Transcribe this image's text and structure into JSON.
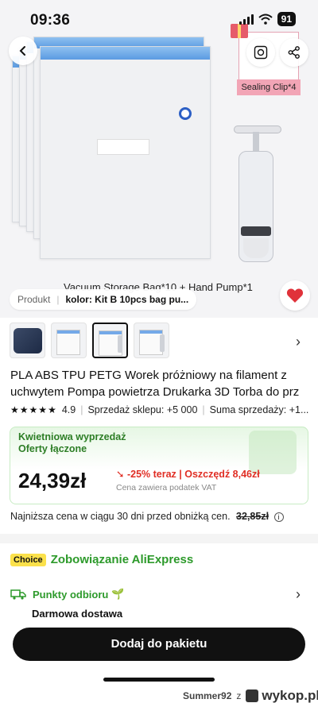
{
  "status_bar": {
    "time": "09:36",
    "battery": "91"
  },
  "hero": {
    "clip_label": "Sealing Clip*4",
    "caption": "Vacuum Storage Bag*10 + Hand Pump*1"
  },
  "breadcrumb": {
    "tab": "Produkt",
    "variant": "kolor: Kit B 10pcs bag pu..."
  },
  "product": {
    "title_line1": "PLA ABS TPU PETG Worek próżniowy na filament z",
    "title_line2": "uchwytem Pompa powietrza Drukarka 3D Torba do prz",
    "rating": "4.9",
    "shop_sales": "Sprzedaż sklepu: +5 000",
    "total_sales": "Suma sprzedaży: +1..."
  },
  "promo": {
    "line1": "Kwietniowa wyprzedaż",
    "line2": "Oferty łączone",
    "price": "24,39zł",
    "discount": "-25% teraz | Oszczędź 8,46zł",
    "vat_note": "Cena zawiera podatek VAT"
  },
  "lowest_price": {
    "text": "Najniższa cena w ciągu 30 dni przed obniżką cen.",
    "old_price": "32,85zł"
  },
  "choice": {
    "badge": "Choice",
    "text": "Zobowiązanie AliExpress"
  },
  "shipping": {
    "pickup": "Punkty odbioru",
    "delivery": "Darmowa dostawa"
  },
  "cta": {
    "label": "Dodaj do pakietu"
  },
  "watermark": {
    "user": "Summer92",
    "z": "z",
    "brand": "wykop.pl"
  },
  "colors": {
    "accent_green": "#2d9a2b",
    "price_red": "#e02e24",
    "cta_bg": "#111111",
    "heart": "#e0323a"
  }
}
